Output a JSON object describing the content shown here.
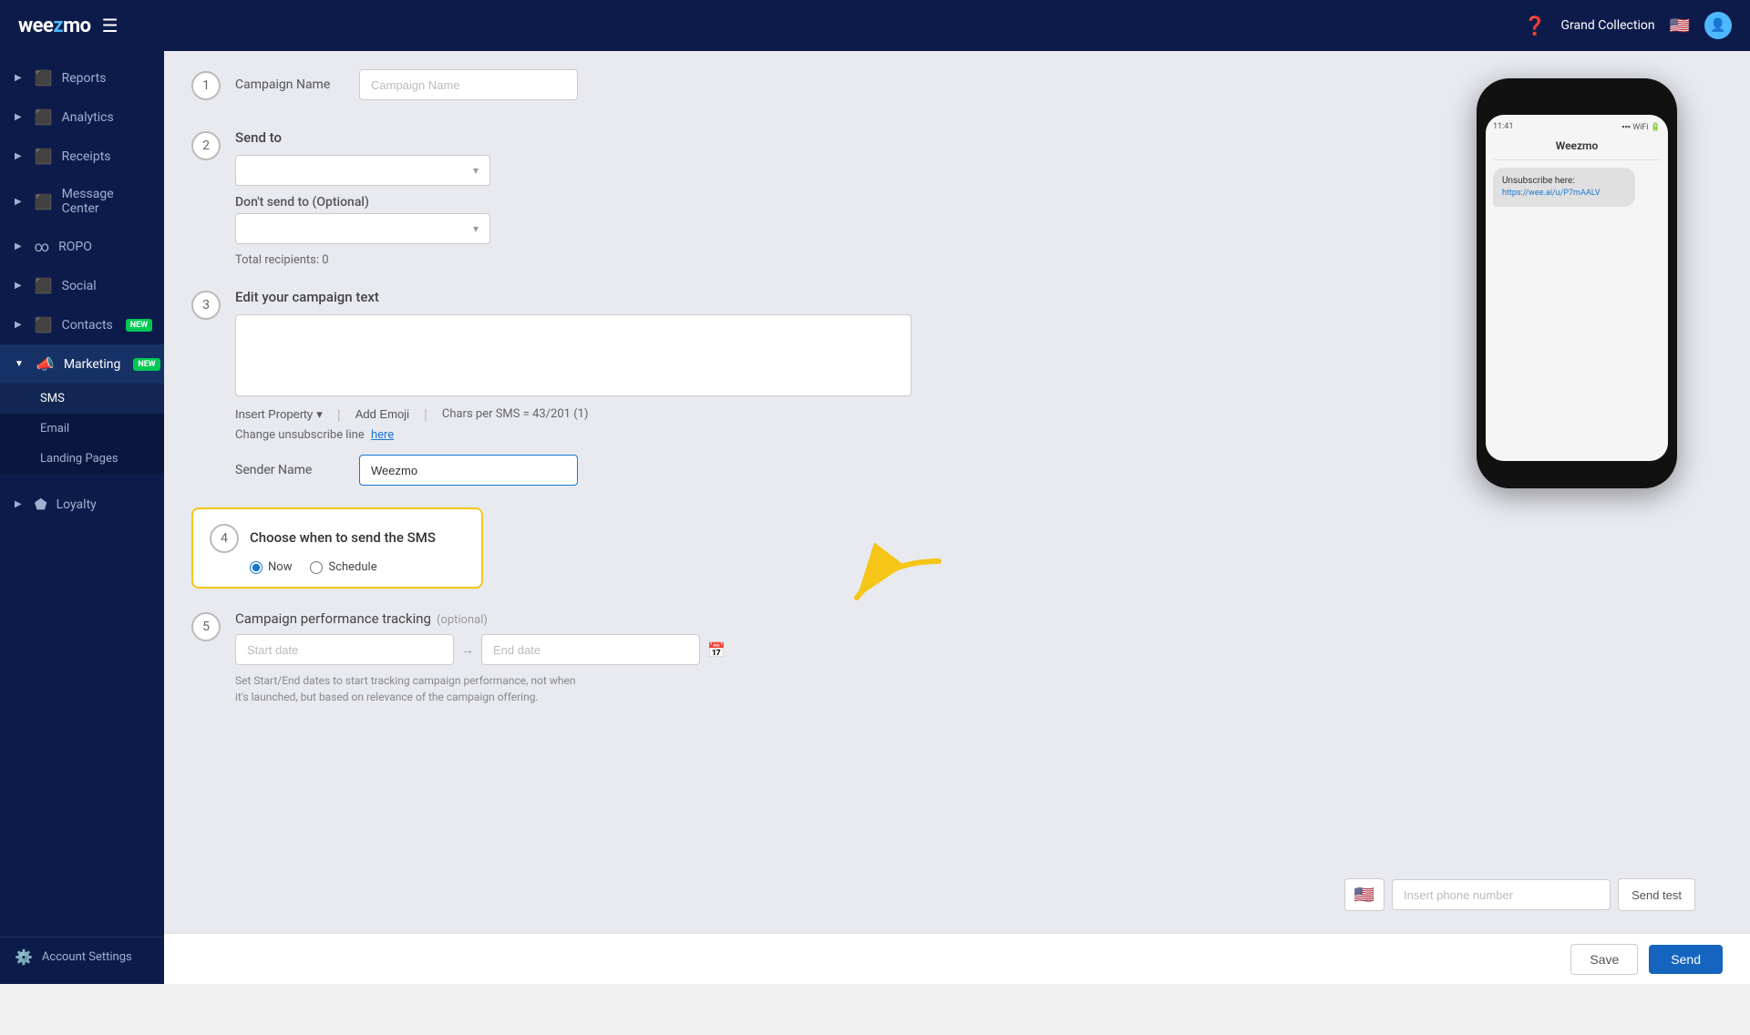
{
  "app": {
    "logo": "weezmo",
    "org_name": "Grand Collection",
    "flag": "🇺🇸"
  },
  "sidebar": {
    "items": [
      {
        "id": "reports",
        "label": "Reports",
        "icon": "📊",
        "arrow": "▶",
        "active": false
      },
      {
        "id": "analytics",
        "label": "Analytics",
        "icon": "📈",
        "arrow": "▶",
        "active": false
      },
      {
        "id": "receipts",
        "label": "Receipts",
        "icon": "🧾",
        "arrow": "▶",
        "active": false
      },
      {
        "id": "message-center",
        "label": "Message Center",
        "icon": "💬",
        "arrow": "▶",
        "active": false
      },
      {
        "id": "ropo",
        "label": "ROPO",
        "icon": "∞",
        "arrow": "▶",
        "active": false
      },
      {
        "id": "social",
        "label": "Social",
        "icon": "👥",
        "arrow": "▶",
        "active": false
      },
      {
        "id": "contacts",
        "label": "Contacts",
        "icon": "📋",
        "arrow": "▶",
        "active": false,
        "badge": "NEW"
      },
      {
        "id": "marketing",
        "label": "Marketing",
        "icon": "📣",
        "arrow": "▼",
        "active": true,
        "badge": "NEW"
      }
    ],
    "sub_items": [
      {
        "id": "sms",
        "label": "SMS",
        "active": true
      },
      {
        "id": "email",
        "label": "Email",
        "active": false
      },
      {
        "id": "landing-pages",
        "label": "Landing Pages",
        "active": false
      }
    ],
    "bottom_items": [
      {
        "id": "loyalty",
        "label": "Loyalty",
        "icon": "🏆",
        "arrow": "▶"
      },
      {
        "id": "account-settings",
        "label": "Account Settings",
        "icon": "⚙️"
      }
    ]
  },
  "form": {
    "step1": {
      "number": "1",
      "campaign_name_label": "Campaign Name",
      "campaign_name_placeholder": "Campaign Name"
    },
    "step2": {
      "number": "2",
      "label": "Send to",
      "dont_send_label": "Don't send to (Optional)",
      "total_label": "Total recipients: 0"
    },
    "step3": {
      "number": "3",
      "label": "Edit your campaign text",
      "insert_property": "Insert Property",
      "add_emoji": "Add Emoji",
      "chars_per_sms": "Chars per SMS = 43/201 (1)",
      "change_unsubscribe": "Change unsubscribe line",
      "here": "here",
      "sender_name_label": "Sender Name",
      "sender_name_value": "Weezmo"
    },
    "step4": {
      "number": "4",
      "label": "Choose when to send the SMS",
      "radio_now": "Now",
      "radio_schedule": "Schedule"
    },
    "step5": {
      "number": "5",
      "label": "Campaign performance tracking",
      "optional": "(optional)",
      "start_placeholder": "Start date",
      "end_placeholder": "End date",
      "hint": "Set Start/End dates to start tracking campaign performance, not when it's launched, but based on relevance of the campaign offering."
    }
  },
  "phone_preview": {
    "title": "Weezmo",
    "sms_text": "Unsubscribe here:",
    "sms_link": "https://wee.ai/u/P7mAALV",
    "time": "11:41",
    "insert_phone_placeholder": "Insert phone number",
    "send_test_label": "Send test"
  },
  "actions": {
    "save_label": "Save",
    "send_label": "Send"
  }
}
